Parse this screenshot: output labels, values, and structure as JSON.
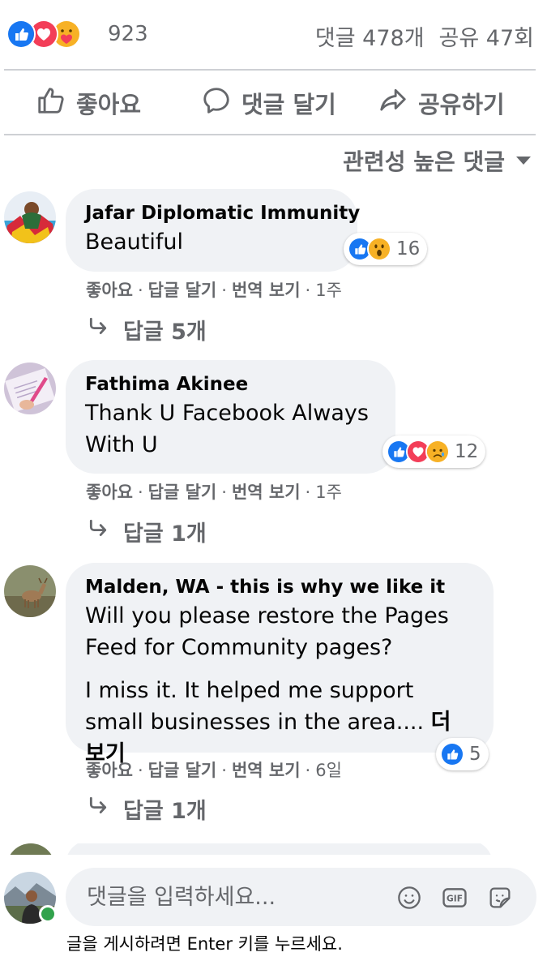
{
  "stats": {
    "reaction_icons": [
      "like-icon",
      "love-icon",
      "care-icon"
    ],
    "reaction_count": "923",
    "comments": "댓글 478개",
    "shares": "공유 47회"
  },
  "actions": {
    "like": "좋아요",
    "comment": "댓글 달기",
    "share": "공유하기"
  },
  "sort": {
    "label": "관련성 높은 댓글"
  },
  "comments": [
    {
      "author": "Jafar Diplomatic Immunity",
      "paragraphs": [
        "Beautiful"
      ],
      "reactions": [
        "like-icon",
        "wow-icon"
      ],
      "reaction_count": "16",
      "actions": [
        "좋아요",
        "답글 달기",
        "번역 보기"
      ],
      "time": "1주",
      "replies": "답글 5개"
    },
    {
      "author": "Fathima Akinee",
      "paragraphs": [
        "Thank U Facebook Always With U"
      ],
      "reactions": [
        "like-icon",
        "love-icon",
        "sad-icon"
      ],
      "reaction_count": "12",
      "actions": [
        "좋아요",
        "답글 달기",
        "번역 보기"
      ],
      "time": "1주",
      "replies": "답글 1개"
    },
    {
      "author": "Malden, WA - this is why we like it",
      "paragraphs": [
        "Will you please restore the Pages Feed for Community pages?",
        "I miss it. It helped me support small businesses in the area...."
      ],
      "see_more": "더 보기",
      "reactions": [
        "like-icon"
      ],
      "reaction_count": "5",
      "actions": [
        "좋아요",
        "답글 달기",
        "번역 보기"
      ],
      "time": "6일",
      "replies": "답글 1개"
    }
  ],
  "composer": {
    "placeholder": "댓글을 입력하세요...",
    "icons": [
      "emoji-icon",
      "gif-icon",
      "sticker-icon"
    ],
    "gif_label": "GIF",
    "hint": "글을 게시하려면 Enter 키를 누르세요."
  },
  "colors": {
    "like_blue": "#1877f2",
    "love_red": "#f33e58",
    "care_yellow": "#f7b125",
    "secondary_text": "#65676b",
    "bubble_bg": "#f0f2f5",
    "online_green": "#31a24c"
  }
}
